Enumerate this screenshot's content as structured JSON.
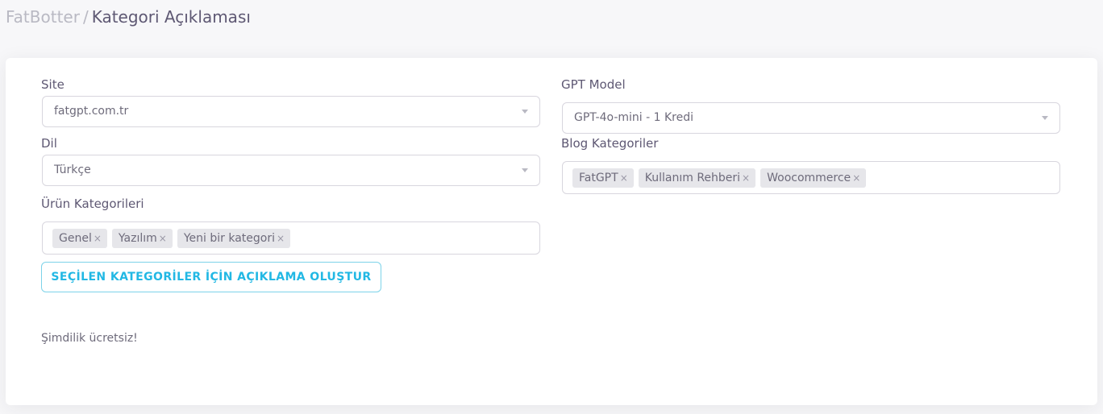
{
  "breadcrumb": {
    "root": "FatBotter",
    "separator": "/",
    "current": "Kategori Açıklaması"
  },
  "form": {
    "site": {
      "label": "Site",
      "value": "fatgpt.com.tr"
    },
    "language": {
      "label": "Dil",
      "value": "Türkçe"
    },
    "product_categories": {
      "label": "Ürün Kategorileri",
      "tags": [
        "Genel",
        "Yazılım",
        "Yeni bir kategori"
      ]
    },
    "generate_button": "SEÇİLEN KATEGORİLER İÇİN AÇIKLAMA OLUŞTUR",
    "note": "Şimdilik ücretsiz!",
    "gpt_model": {
      "label": "GPT Model",
      "value": "GPT-4o-mini - 1 Kredi"
    },
    "blog_categories": {
      "label": "Blog Kategoriler",
      "tags": [
        "FatGPT",
        "Kullanım Rehberi",
        "Woocommerce"
      ]
    },
    "remove_glyph": "×"
  },
  "icons": {
    "select_caret": "chevron-down-icon",
    "tag_remove": "close-icon"
  },
  "colors": {
    "page_bg": "#f7f7f9",
    "card_bg": "#ffffff",
    "accent": "#22b8e4",
    "tag_bg": "#e6e6ea"
  }
}
